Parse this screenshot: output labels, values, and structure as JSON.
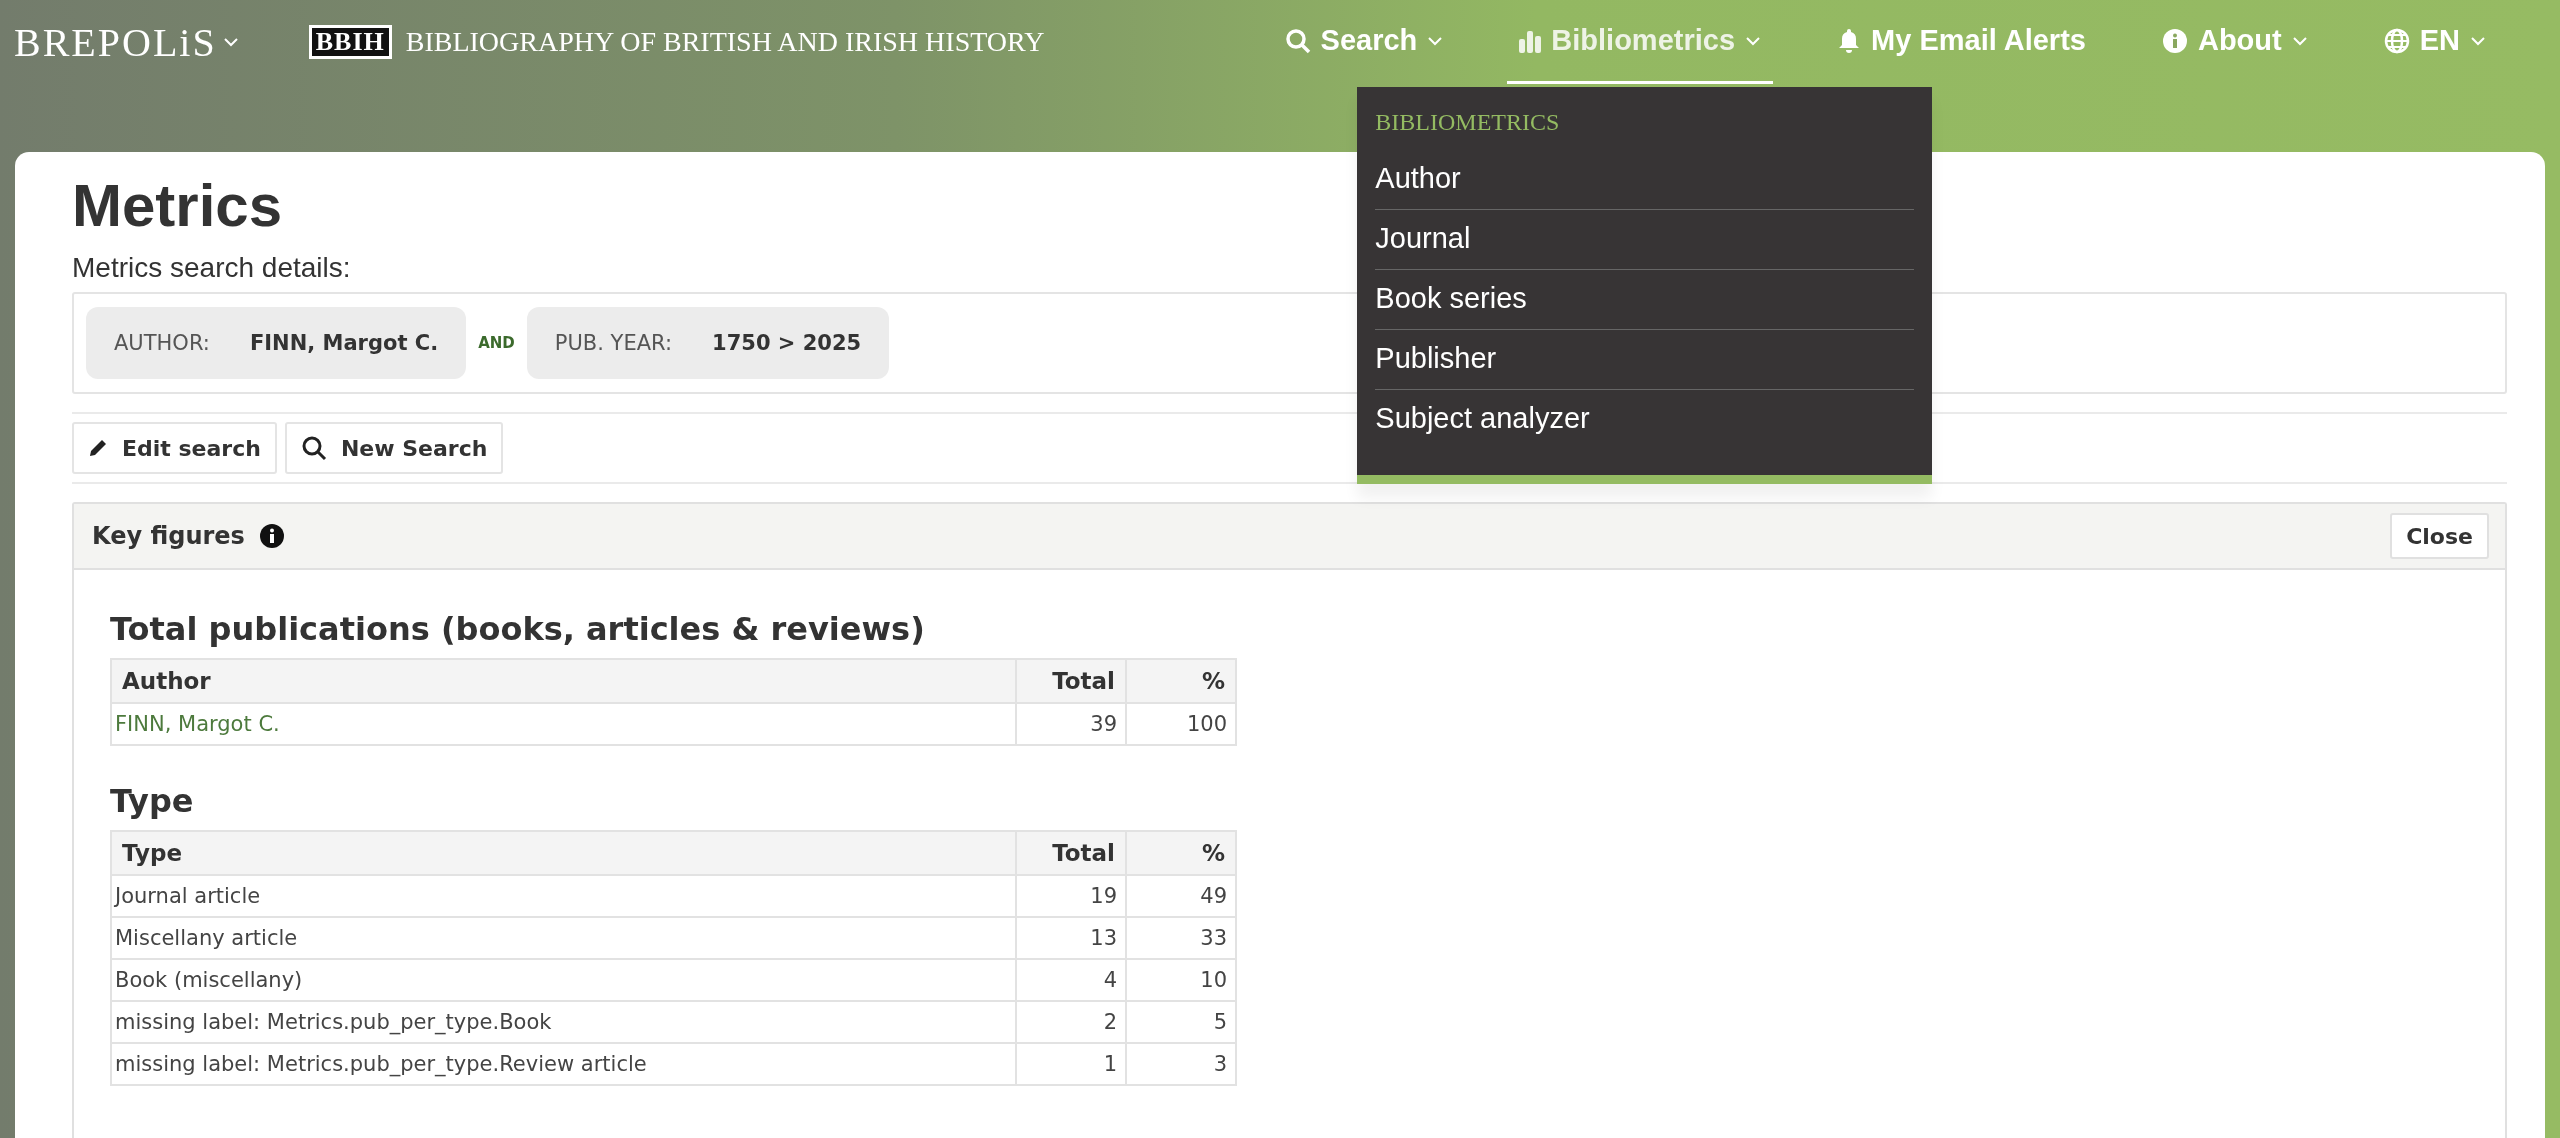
{
  "header": {
    "brand": "BREPOLiS",
    "site_mark": "BBIH",
    "site_title": "BIBLIOGRAPHY OF BRITISH AND IRISH HISTORY",
    "nav": [
      {
        "kind": "search",
        "label": "Search",
        "has_menu": true,
        "selected": false
      },
      {
        "kind": "metrics",
        "label": "Bibliometrics",
        "has_menu": true,
        "selected": true,
        "menu": {
          "heading": "BIBLIOMETRICS",
          "items": [
            "Author",
            "Journal",
            "Book series",
            "Publisher",
            "Subject analyzer"
          ]
        }
      },
      {
        "kind": "alerts",
        "label": "My Email Alerts",
        "has_menu": false,
        "selected": false
      },
      {
        "kind": "about",
        "label": "About",
        "has_menu": true,
        "selected": false
      },
      {
        "kind": "language",
        "label": "EN",
        "has_menu": true,
        "selected": false
      }
    ]
  },
  "page": {
    "title": "Metrics",
    "details_label": "Metrics search details:",
    "criteria": [
      {
        "field": "AUTHOR:",
        "value": "FINN, Margot C."
      },
      {
        "connector": "AND",
        "field": "PUB. YEAR:",
        "value": "1750 > 2025"
      }
    ],
    "actions": [
      {
        "kind": "edit",
        "label": "Edit search"
      },
      {
        "kind": "search",
        "label": "New Search"
      }
    ],
    "panel": {
      "title": "Key figures",
      "close": "Close",
      "sections": [
        {
          "heading": "Total publications (books, articles & reviews)",
          "columns": [
            "Author",
            "Total",
            "%"
          ],
          "rows": [
            {
              "link": true,
              "cells": [
                "FINN, Margot C.",
                "39",
                "100"
              ]
            }
          ]
        },
        {
          "heading": "Type",
          "columns": [
            "Type",
            "Total",
            "%"
          ],
          "rows": [
            {
              "link": false,
              "cells": [
                "Journal article",
                "19",
                "49"
              ]
            },
            {
              "link": false,
              "cells": [
                "Miscellany article",
                "13",
                "33"
              ]
            },
            {
              "link": false,
              "cells": [
                "Book (miscellany)",
                "4",
                "10"
              ]
            },
            {
              "link": false,
              "cells": [
                "missing label: Metrics.pub_per_type.Book",
                "2",
                "5"
              ]
            },
            {
              "link": false,
              "cells": [
                "missing label: Metrics.pub_per_type.Review article",
                "1",
                "3"
              ]
            }
          ]
        }
      ]
    }
  }
}
